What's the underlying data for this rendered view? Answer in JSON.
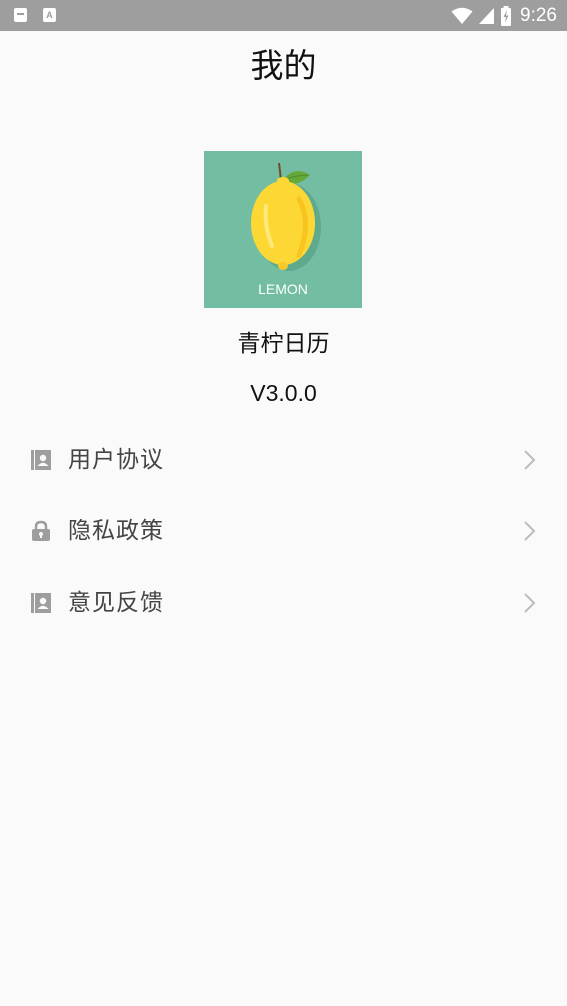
{
  "status_bar": {
    "time": "9:26",
    "notification_icons": [
      "sd-card-icon",
      "a-icon"
    ],
    "system_icons": [
      "wifi-icon",
      "signal-icon",
      "battery-charging-icon"
    ]
  },
  "header": {
    "title": "我的"
  },
  "app": {
    "logo_text": "LEMON",
    "name": "青柠日历",
    "version": "V3.0.0"
  },
  "menu": [
    {
      "label": "用户协议",
      "icon": "contact-book-icon"
    },
    {
      "label": "隐私政策",
      "icon": "lock-icon"
    },
    {
      "label": "意见反馈",
      "icon": "contact-book-icon"
    }
  ],
  "colors": {
    "status_bar": "#9e9e9e",
    "background": "#fafafa",
    "logo_background": "#73bea2",
    "lemon": "#fdd835"
  }
}
